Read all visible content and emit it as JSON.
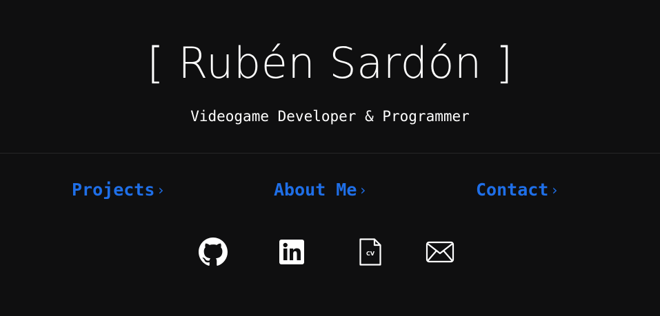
{
  "header": {
    "title": "[ Rubén Sardón ]",
    "subtitle": "Videogame Developer & Programmer"
  },
  "nav": {
    "items": [
      {
        "label": "Projects",
        "chevron": "›"
      },
      {
        "label": "About Me",
        "chevron": "›"
      },
      {
        "label": "Contact",
        "chevron": "›"
      }
    ]
  },
  "social": {
    "icons": [
      "github-icon",
      "linkedin-icon",
      "cv-document-icon",
      "mail-icon"
    ],
    "cv_badge": "CV"
  },
  "colors": {
    "background": "#0f0f10",
    "text": "#ffffff",
    "accent": "#1f6fe8"
  }
}
